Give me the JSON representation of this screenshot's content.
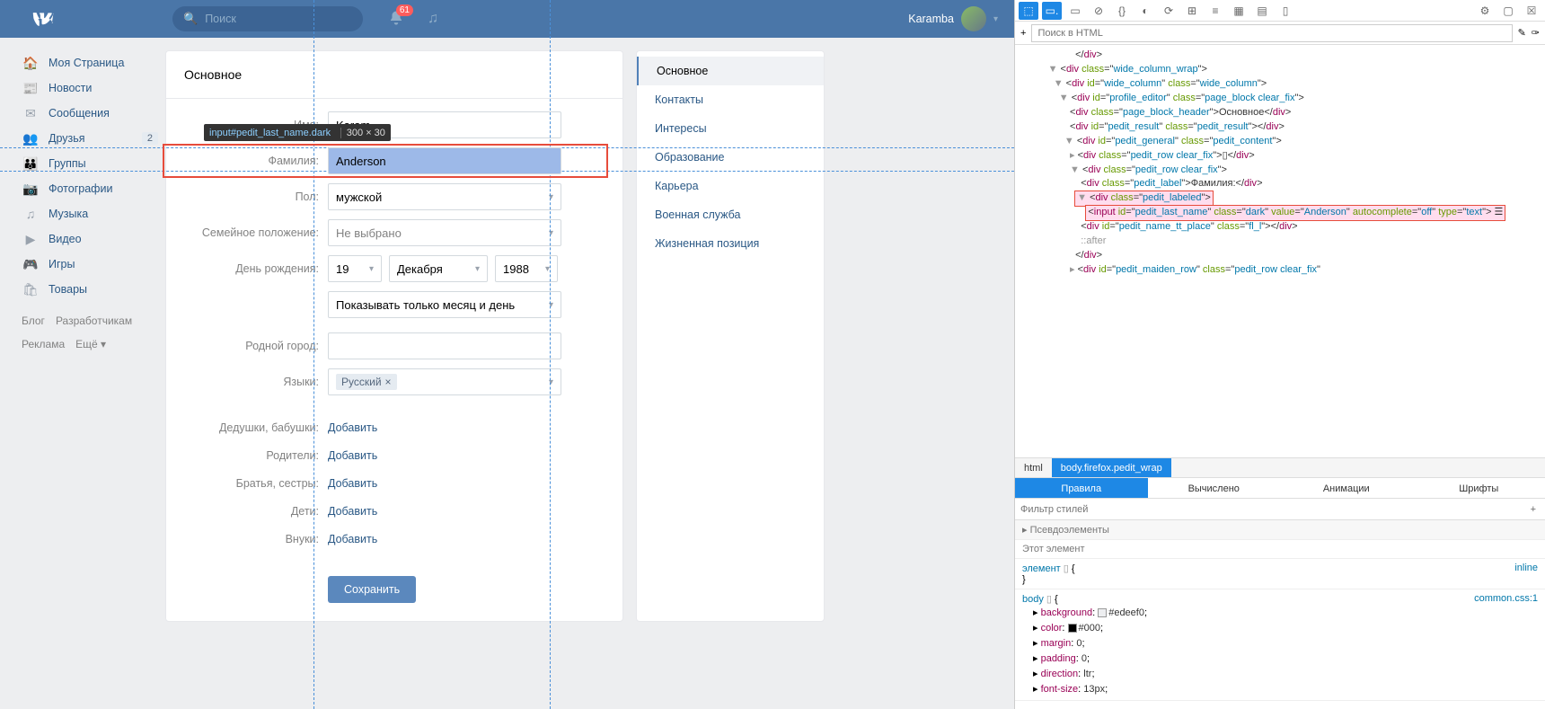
{
  "header": {
    "search_placeholder": "Поиск",
    "notif_count": "61",
    "username": "Karamba"
  },
  "left_nav": {
    "items": [
      {
        "label": "Моя Страница",
        "icon": "🏠"
      },
      {
        "label": "Новости",
        "icon": "📰"
      },
      {
        "label": "Сообщения",
        "icon": "✉"
      },
      {
        "label": "Друзья",
        "icon": "👥",
        "badge": "2"
      },
      {
        "label": "Группы",
        "icon": "👪"
      },
      {
        "label": "Фотографии",
        "icon": "📷"
      },
      {
        "label": "Музыка",
        "icon": "♫"
      },
      {
        "label": "Видео",
        "icon": "▶"
      },
      {
        "label": "Игры",
        "icon": "🎮"
      },
      {
        "label": "Товары",
        "icon": "🛍"
      }
    ],
    "footer": [
      "Блог",
      "Разработчикам",
      "Реклама",
      "Ещё ▾"
    ]
  },
  "main": {
    "title": "Основное",
    "labels": {
      "name": "Имя:",
      "surname": "Фамилия:",
      "gender": "Пол:",
      "marital": "Семейное положение:",
      "birthday": "День рождения:",
      "hometown": "Родной город:",
      "languages": "Языки:",
      "grandparents": "Дедушки, бабушки:",
      "parents": "Родители:",
      "siblings": "Братья, сестры:",
      "children": "Дети:",
      "grandchildren": "Внуки:"
    },
    "values": {
      "name": "Karam",
      "surname": "Anderson",
      "gender": "мужской",
      "marital": "Не выбрано",
      "bday_day": "19",
      "bday_month": "Декабря",
      "bday_year": "1988",
      "bday_vis": "Показывать только месяц и день",
      "language": "Русский"
    },
    "add_link": "Добавить",
    "save": "Сохранить",
    "inspect_tooltip_selector": "input#pedit_last_name.dark",
    "inspect_tooltip_dim": "300 × 30"
  },
  "side_tabs": [
    "Основное",
    "Контакты",
    "Интересы",
    "Образование",
    "Карьера",
    "Военная служба",
    "Жизненная позиция"
  ],
  "devtools": {
    "search_placeholder": "Поиск в HTML",
    "crumbs": [
      "html",
      "body.firefox.pedit_wrap"
    ],
    "subtabs": [
      "Правила",
      "Вычислено",
      "Анимации",
      "Шрифты"
    ],
    "filter_placeholder": "Фильтр стилей",
    "pseudo": "Псевдоэлементы",
    "this_element": "Этот элемент",
    "inline": "inline",
    "element_selector": "элемент",
    "body_selector": "body",
    "src": "common.css:1",
    "rules": [
      {
        "prop": "background",
        "val": "#edeef0",
        "swatch": "#edeef0"
      },
      {
        "prop": "color",
        "val": "#000",
        "swatch": "#000"
      },
      {
        "prop": "margin",
        "val": "0"
      },
      {
        "prop": "padding",
        "val": "0"
      },
      {
        "prop": "direction",
        "val": "ltr"
      },
      {
        "prop": "font-size",
        "val": "13px"
      }
    ],
    "html_lines": [
      {
        "indent": 20,
        "text_html": "&lt;/<span class='tag'>div</span>&gt;"
      },
      {
        "indent": 10,
        "tw": "▼",
        "text_html": "&lt;<span class='tag'>div</span> <span class='attr'>class</span>=&quot;<span class='attrv'>wide_column_wrap</span>&quot;&gt;"
      },
      {
        "indent": 12,
        "tw": "▼",
        "text_html": "&lt;<span class='tag'>div</span> <span class='attr'>id</span>=&quot;<span class='attrv'>wide_column</span>&quot; <span class='attr'>class</span>=&quot;<span class='attrv'>wide_column</span>&quot;&gt;"
      },
      {
        "indent": 14,
        "tw": "▼",
        "text_html": "&lt;<span class='tag'>div</span> <span class='attr'>id</span>=&quot;<span class='attrv'>profile_editor</span>&quot; <span class='attr'>class</span>=&quot;<span class='attrv'>page_block clear_fix</span>&quot;&gt;"
      },
      {
        "indent": 18,
        "text_html": "&lt;<span class='tag'>div</span> <span class='attr'>class</span>=&quot;<span class='attrv'>page_block_header</span>&quot;&gt;Основное&lt;/<span class='tag'>div</span>&gt;"
      },
      {
        "indent": 18,
        "text_html": "&lt;<span class='tag'>div</span> <span class='attr'>id</span>=&quot;<span class='attrv'>pedit_result</span>&quot; <span class='attr'>class</span>=&quot;<span class='attrv'>pedit_result</span>&quot;&gt;&lt;/<span class='tag'>div</span>&gt;"
      },
      {
        "indent": 16,
        "tw": "▼",
        "text_html": "&lt;<span class='tag'>div</span> <span class='attr'>id</span>=&quot;<span class='attrv'>pedit_general</span>&quot; <span class='attr'>class</span>=&quot;<span class='attrv'>pedit_content</span>&quot;&gt;"
      },
      {
        "indent": 18,
        "tw": "▸",
        "text_html": "&lt;<span class='tag'>div</span> <span class='attr'>class</span>=&quot;<span class='attrv'>pedit_row clear_fix</span>&quot;&gt;▯&lt;/<span class='tag'>div</span>&gt;"
      },
      {
        "indent": 18,
        "tw": "▼",
        "text_html": "&lt;<span class='tag'>div</span> <span class='attr'>class</span>=&quot;<span class='attrv'>pedit_row clear_fix</span>&quot;&gt;"
      },
      {
        "indent": 22,
        "text_html": "&lt;<span class='tag'>div</span> <span class='attr'>class</span>=&quot;<span class='attrv'>pedit_label</span>&quot;&gt;Фамилия:&lt;/<span class='tag'>div</span>&gt;"
      },
      {
        "indent": 20,
        "tw": "▼",
        "text_html": "&lt;<span class='tag'>div</span> <span class='attr'>class</span>=&quot;<span class='attrv'>pedit_labeled</span>&quot;&gt;",
        "hl_start": true
      },
      {
        "indent": 24,
        "text_html": "&lt;<span class='tag'>input</span> <span class='attr'>id</span>=&quot;<span class='attrv'>pedit_last_name</span>&quot; <span class='attr'>class</span>=&quot;<span class='attrv'>dark</span>&quot; <span class='attr'>value</span>=&quot;<span class='attrv'>Anderson</span>&quot; <span class='attr'>autocomplete</span>=&quot;<span class='attrv'>off</span>&quot; <span class='attr'>type</span>=&quot;<span class='attrv'>text</span>&quot;&gt; ☰",
        "hl": true
      },
      {
        "indent": 22,
        "text_html": "&lt;<span class='tag'>div</span> <span class='attr'>id</span>=&quot;<span class='attrv'>pedit_name_tt_place</span>&quot; <span class='attr'>class</span>=&quot;<span class='attrv'>fl_l</span>&quot;&gt;&lt;/<span class='tag'>div</span>&gt;"
      },
      {
        "indent": 22,
        "text_html": "<span class='tw'>::after</span>"
      },
      {
        "indent": 20,
        "text_html": "&lt;/<span class='tag'>div</span>&gt;"
      },
      {
        "indent": 18,
        "tw": "▸",
        "text_html": "&lt;<span class='tag'>div</span> <span class='attr'>id</span>=&quot;<span class='attrv'>pedit_maiden_row</span>&quot; <span class='attr'>class</span>=&quot;<span class='attrv'>pedit_row clear_fix</span>&quot;"
      }
    ]
  }
}
